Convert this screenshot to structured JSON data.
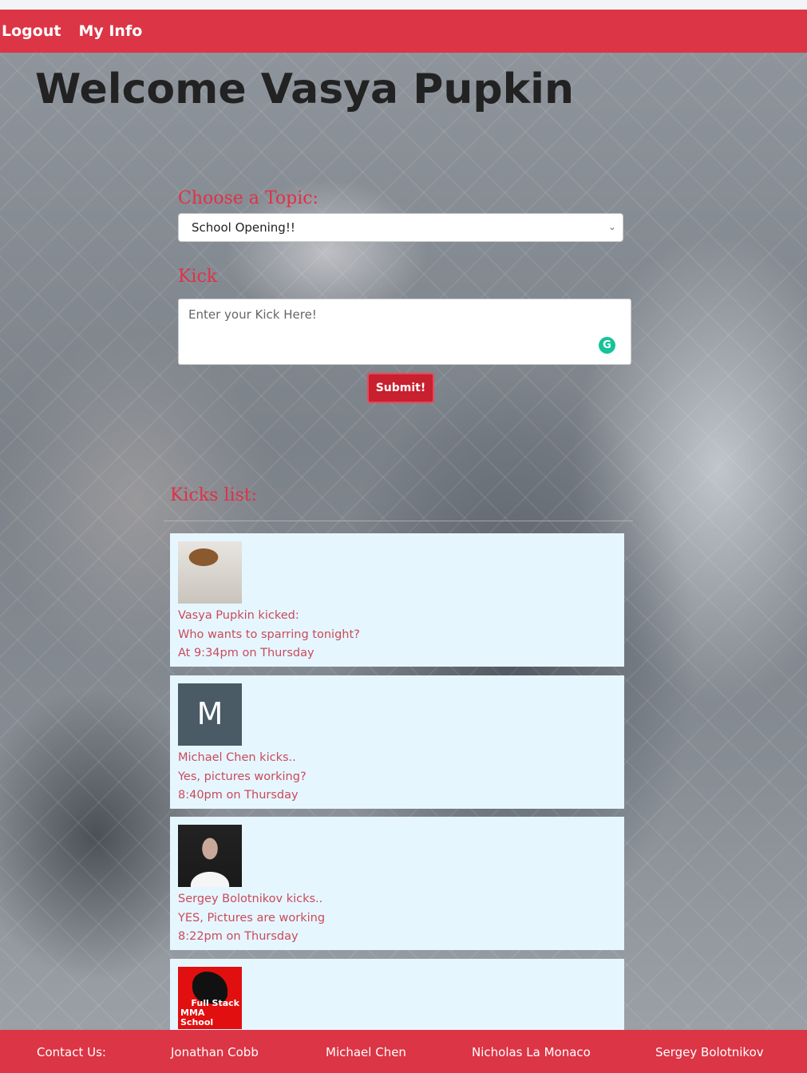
{
  "nav": {
    "logout": "Logout",
    "my_info": "My Info"
  },
  "welcome": "Welcome Vasya Pupkin",
  "form": {
    "topic_label": "Choose a Topic:",
    "topic_selected": "School Opening!!",
    "kick_label": "Kick",
    "kick_placeholder": "Enter your Kick Here!",
    "grammarly_icon": "G",
    "submit_label": "Submit!"
  },
  "kicks_label": "Kicks list:",
  "kicks": [
    {
      "avatar": "photo",
      "author_line": "Vasya Pupkin kicked:",
      "message": "Who wants to sparring tonight?",
      "time": "At 9:34pm on Thursday"
    },
    {
      "avatar": "letter",
      "avatar_letter": "M",
      "author_line": "Michael Chen kicks..",
      "message": "Yes, pictures working?",
      "time": "8:40pm on Thursday"
    },
    {
      "avatar": "photo",
      "author_line": "Sergey Bolotnikov kicks..",
      "message": "YES, Pictures are working",
      "time": "8:22pm on Thursday"
    },
    {
      "avatar": "logo",
      "avatar_text_1": "Full Stack",
      "avatar_text_2": "MMA School"
    }
  ],
  "footer": {
    "contact": "Contact Us:",
    "names": [
      "Jonathan Cobb",
      "Michael Chen",
      "Nicholas La Monaco",
      "Sergey Bolotnikov"
    ]
  },
  "colors": {
    "brand_red": "#dc3545",
    "card_bg": "#e6f6ff",
    "accent_text": "#e13047"
  }
}
